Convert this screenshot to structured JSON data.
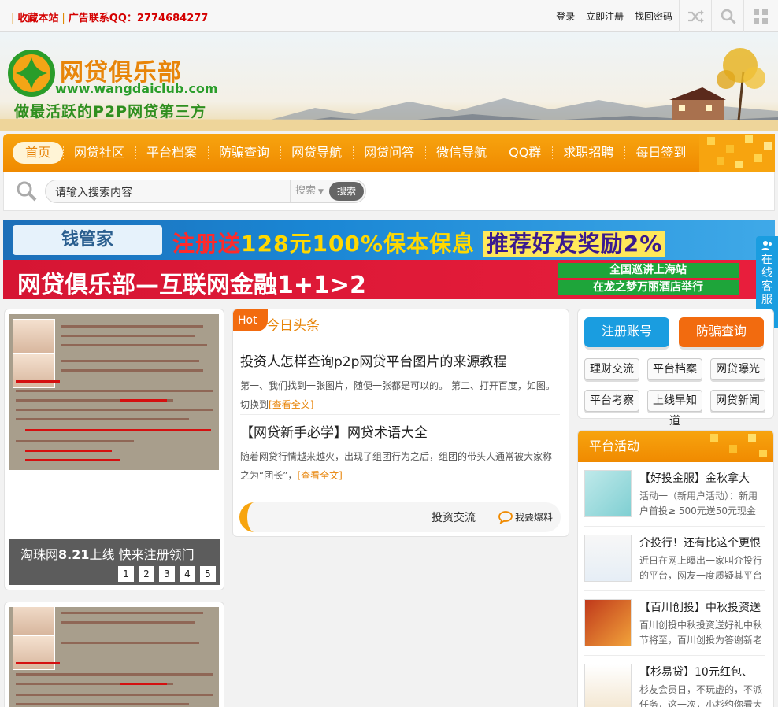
{
  "topbar": {
    "bookmark": "收藏本站",
    "ad_contact": "广告联系QQ：2774684277",
    "login": "登录",
    "register": "立即注册",
    "forgot": "找回密码"
  },
  "header": {
    "logo_text": "网贷俱乐部",
    "logo_url": "www.wangdaiclub.com",
    "slogan": "做最活跃的P2P网贷第三方"
  },
  "nav": {
    "items": [
      "首页",
      "网贷社区",
      "平台档案",
      "防骗查询",
      "网贷导航",
      "网贷问答",
      "微信导航",
      "QQ群",
      "求职招聘",
      "每日签到"
    ]
  },
  "search": {
    "value": "请输入搜索内容",
    "type": "搜索",
    "button": "搜索"
  },
  "banners": {
    "b1_brand": "钱管家",
    "b1_reg": "注册送",
    "b1_amount": "128元",
    "b1_guarantee": "100%保本保息",
    "b1_refer": "推荐好友奖励2%",
    "b2_text": "网贷俱乐部—互联网金融1+1>2",
    "b2_tour": "全国巡讲上海站",
    "b2_venue": "在龙之梦万丽酒店举行"
  },
  "kefu": [
    "在",
    "线",
    "客",
    "服",
    "≪"
  ],
  "slider": {
    "caption_prefix": "淘珠网",
    "caption_bold": "8.21",
    "caption_suffix": "上线  快来注册领门",
    "pages": [
      "1",
      "2",
      "3",
      "4",
      "5"
    ]
  },
  "headlines": {
    "hot": "Hot",
    "title": "今日头条",
    "articles": [
      {
        "title": "投资人怎样查询p2p网贷平台图片的来源教程",
        "desc": "第一、我们找到一张图片，随便一张都是可以的。 第二、打开百度，如图。切换到",
        "more": "[查看全文]"
      },
      {
        "title": "【网贷新手必学】网贷术语大全",
        "desc": "随着网贷行情越来越火，出现了组团行为之后，组团的带头人通常被大家称之为“团长”，",
        "more": "[查看全文]"
      }
    ],
    "ticker_text": "投资交流",
    "ticker_tip": "我要爆料"
  },
  "quick": {
    "register": "注册账号",
    "fraud_check": "防骗查询",
    "tags": [
      "理财交流",
      "平台档案",
      "网贷曝光",
      "平台考察",
      "上线早知道",
      "网贷新闻"
    ]
  },
  "activities": {
    "title": "平台活动",
    "items": [
      {
        "title": "【好投金服】金秋拿大",
        "desc": "活动一（新用户活动）：新用户首投≥ 500元送50元现金"
      },
      {
        "title": "介投行！还有比这个更恨",
        "desc": "近日在网上曝出一家叫介投行的平台，网友一度质疑其平台"
      },
      {
        "title": "【百川创投】中秋投资送",
        "desc": "百川创投中秋投资送好礼中秋节将至，百川创投为答谢新老"
      },
      {
        "title": "【杉易贷】10元红包、",
        "desc": "杉友会员日，不玩虚的，不派任务，这一次，小杉约你看大"
      }
    ]
  },
  "colors": {
    "accent": "#f08a00",
    "red": "#d40000",
    "blue_btn": "#1a9de0"
  }
}
